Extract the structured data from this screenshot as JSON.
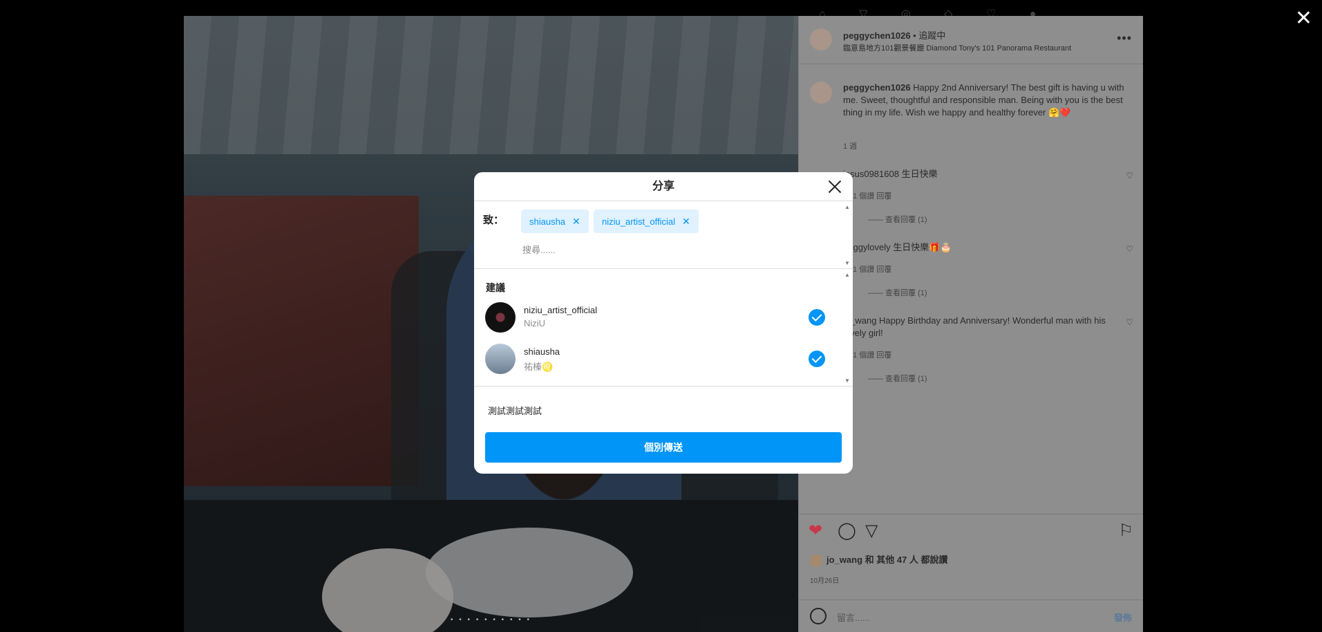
{
  "post": {
    "username": "peggychen1026",
    "follow_status": "• 追蹤中",
    "location": "臨意島地方101觀景餐廳 Diamond Tony's 101 Panorama Restaurant",
    "more_icon": "more-horizontal-icon",
    "caption_user": "peggychen1026",
    "caption_text": "Happy 2nd Anniversary! The best gift is having u with me. Sweet, thoughtful and responsible man. Being with you is the best thing in my life. Wish we happy and healthy forever 🤗❤️",
    "caption_time": "1 週",
    "comments": [
      {
        "text": "jesus0981608 生日快樂",
        "meta": "週    1 個讚    回覆",
        "replies": "—— 查看回覆 (1)"
      },
      {
        "text": "peggylovely 生日快樂🎁🎂",
        "meta": "週    1 個讚    回覆",
        "replies": "—— 查看回覆 (1)"
      },
      {
        "text": "jo_wang Happy Birthday and Anniversary! Wonderful man with his lovely girl!",
        "meta": "週    1 個讚    回覆",
        "replies": "—— 查看回覆 (1)"
      }
    ],
    "likes_user": "jo_wang",
    "likes_text": " 和 其他 47 人 都說讚",
    "date": "10月26日",
    "comment_placeholder": "留言......",
    "post_button": "發佈",
    "photo_dots": "• • • • • • • • • •",
    "heart_color": "#ed4956"
  },
  "share_modal": {
    "title": "分享",
    "to_label": "致：",
    "chips": [
      "shiausha",
      "niziu_artist_official"
    ],
    "search_placeholder": "搜尋......",
    "suggestions_title": "建議",
    "suggestions": [
      {
        "username": "niziu_artist_official",
        "name": "NiziU",
        "checked": true
      },
      {
        "username": "shiausha",
        "name": "祐榛♌",
        "checked": true
      }
    ],
    "message": "測試測試測試",
    "send_button": "個別傳送",
    "accent": "#0095f6"
  }
}
